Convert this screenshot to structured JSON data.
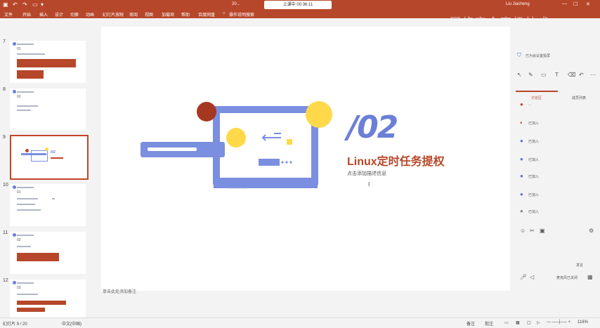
{
  "titlebar": {
    "file_name": "20...",
    "timer": "上课中 00:36:11",
    "user": "Liu Jiacheng",
    "watermark": "网络安全高级技术"
  },
  "menu": [
    "文件",
    "开始",
    "插入",
    "设计",
    "切换",
    "动画",
    "幻灯片放映",
    "审阅",
    "视图",
    "加载项",
    "帮助",
    "百度网盘"
  ],
  "search_hint": "操作说明搜索",
  "slides": [
    {
      "num": "7",
      "label": "01"
    },
    {
      "num": "8",
      "label": "02"
    },
    {
      "num": "9",
      "label": "/02"
    },
    {
      "num": "10",
      "label": "01"
    },
    {
      "num": "11",
      "label": "02"
    },
    {
      "num": "12",
      "label": "03"
    }
  ],
  "slide": {
    "number": "/02",
    "title": "Linux定时任务提权",
    "subtitle": "点击添加描述信息"
  },
  "notes_placeholder": "单击此处添加备注",
  "right_panel": {
    "header": "已为会议室投屏",
    "tab_discussion": "讨论区",
    "tab_members": "成员列表",
    "messages": [
      "...",
      "已加入",
      "已加入",
      "已加入",
      "已加入",
      "已加入",
      "已加入"
    ],
    "speaker_btn": "发言",
    "mic_status": "麦克风已关闭"
  },
  "statusbar": {
    "slide_pos": "幻灯片 9 / 20",
    "language": "中文(中国)",
    "notes": "备注",
    "comments": "批注",
    "zoom": "116%"
  }
}
